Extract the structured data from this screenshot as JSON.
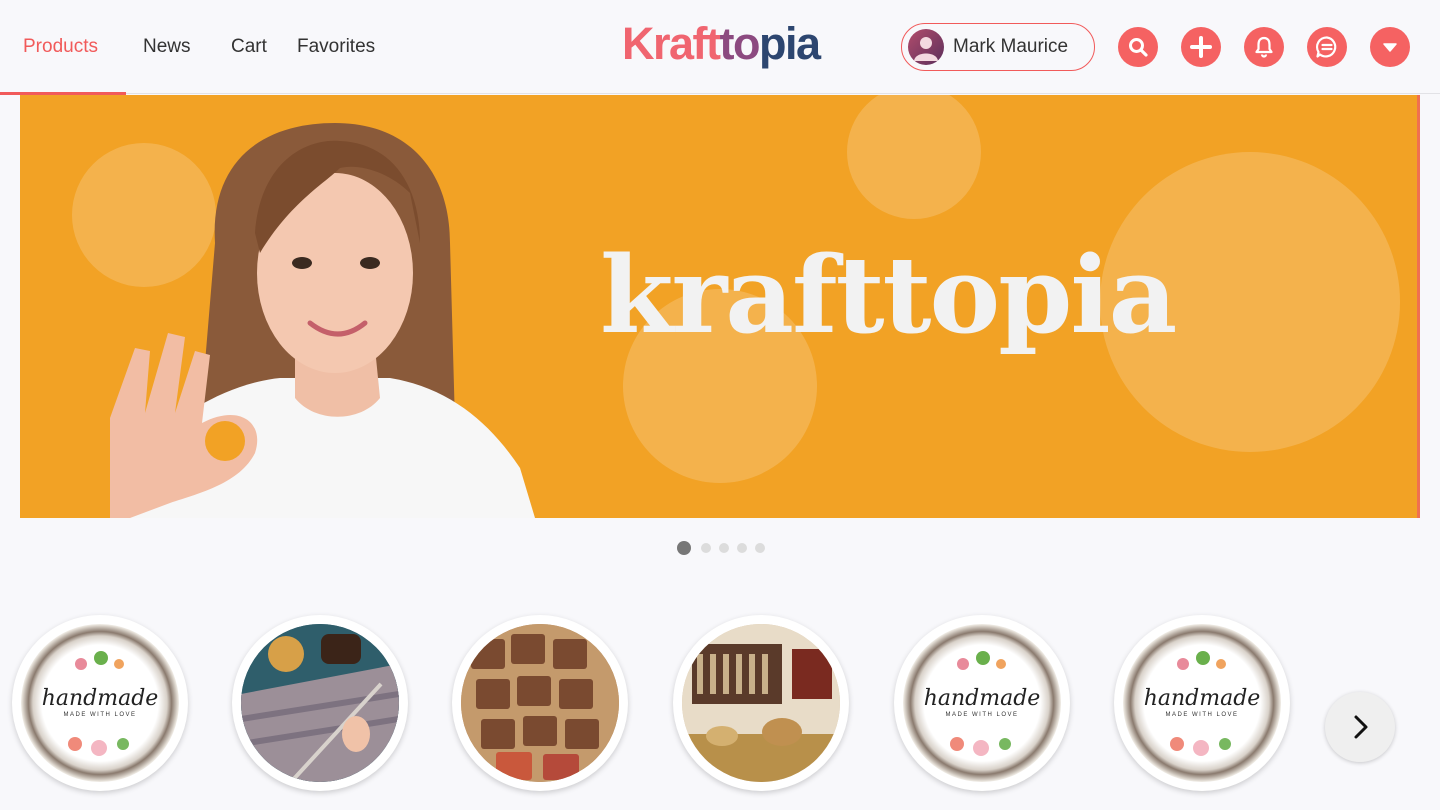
{
  "nav": {
    "items": [
      {
        "label": "Products",
        "active": true
      },
      {
        "label": "News",
        "active": false
      },
      {
        "label": "Cart",
        "active": false
      },
      {
        "label": "Favorites",
        "active": false
      }
    ]
  },
  "brand": {
    "part1": "Kraft",
    "part2": "to",
    "part3": "pia",
    "colors": {
      "primary": "#f06570",
      "accent": "#8c4a80",
      "dark": "#2d4670"
    }
  },
  "user": {
    "name": "Mark Maurice"
  },
  "header_actions": [
    {
      "icon": "search-icon"
    },
    {
      "icon": "plus-icon"
    },
    {
      "icon": "bell-icon"
    },
    {
      "icon": "chat-icon"
    },
    {
      "icon": "chevron-down-icon"
    }
  ],
  "banner": {
    "logo_text": "krafttopia",
    "background": "#f2a225"
  },
  "carousel": {
    "slides": 5,
    "active_index": 0
  },
  "categories": [
    {
      "title": "handmade",
      "subtitle": "MADE WITH LOVE",
      "kind": "handmade-logo"
    },
    {
      "kind": "knitting-photo"
    },
    {
      "kind": "leather-tags-photo"
    },
    {
      "kind": "shop-photo"
    },
    {
      "title": "handmade",
      "subtitle": "MADE WITH LOVE",
      "kind": "handmade-logo"
    },
    {
      "title": "handmade",
      "subtitle": "MADE WITH LOVE",
      "kind": "handmade-logo"
    }
  ],
  "accent_color": "#f15a5a"
}
